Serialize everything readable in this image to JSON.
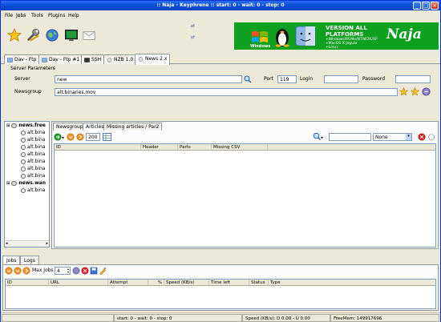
{
  "window": {
    "title": ":: Naja - Keyphrene :: start: 0 - wait: 0 - stop: 0",
    "controls": [
      "_",
      "□",
      "×"
    ]
  },
  "menu": [
    "File",
    "Jobs",
    "Tools",
    "Plugins",
    "Help"
  ],
  "toolbar": {
    "icons": [
      "star-icon",
      "wrench-icon",
      "globe-icon",
      "monitor-icon",
      "mail-icon"
    ],
    "banner": {
      "windows_label": "Windows",
      "version_line": "VERSION ALL PLATFORMS",
      "platforms": [
        "+Windows9X/Me/NT/W2K/XP",
        "+MacOS X Jaguar",
        "+Linux"
      ],
      "logo": "Naja"
    }
  },
  "tabs": [
    {
      "label": "Dav - Ftp"
    },
    {
      "label": "Dav - Ftp #1"
    },
    {
      "label": "SSH"
    },
    {
      "label": "NZB 1.0"
    },
    {
      "label": "News 2.x"
    }
  ],
  "server_params": {
    "group_label": "Server Parameters",
    "server_label": "Server",
    "server_value": "new",
    "port_label": "Port",
    "port_value": "119",
    "login_label": "Login",
    "login_value": "",
    "password_label": "Password",
    "password_value": "",
    "newsgroup_label": "Newsgroup",
    "newsgroup_value": "alt.binaries.mov"
  },
  "tree": {
    "groups": [
      {
        "label": "news.free",
        "children": [
          "alt.bina",
          "alt.bina",
          "alt.bina",
          "alt.bina",
          "alt.bina",
          "alt.bina",
          "alt.bina"
        ]
      },
      {
        "label": "news.wan",
        "children": [
          "alt.bina"
        ]
      }
    ]
  },
  "articles_panel": {
    "tabs": [
      "Newsgroups",
      "Articles",
      "Missing articles / Par2"
    ],
    "count_value": "200",
    "filter_select": "None",
    "columns": [
      "ID",
      "Header",
      "Parts",
      "Missing CSV"
    ]
  },
  "bottom": {
    "tabs": [
      "Jobs",
      "Logs"
    ],
    "max_jobs_label": "Max Jobs",
    "max_jobs_value": "4",
    "columns": [
      "ID",
      "URL",
      "Attempt",
      "%",
      "Speed (KB/s)",
      "Time left",
      "Status",
      "Type"
    ]
  },
  "status": {
    "counts": "start: 0 - wait: 0 - stop: 0",
    "speed": "Speed (KB/s): D 0.00 - U 0.00",
    "freemem": "FreeMem: 149917696"
  }
}
